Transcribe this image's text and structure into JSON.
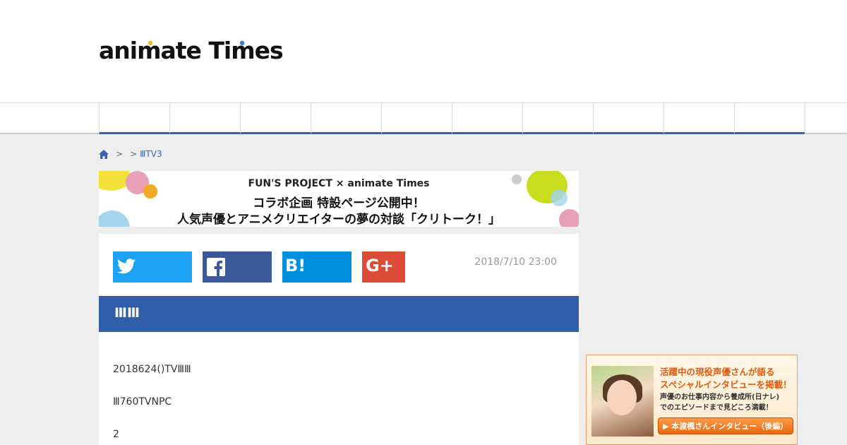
{
  "header": {
    "logo_part1": "an",
    "logo_i": "i",
    "logo_part2": "mate T",
    "logo_part3": "i",
    "logo_part4": "mes"
  },
  "breadcrumb": {
    "home_icon": "home-icon",
    "sep1": ">",
    "sep2": ">",
    "current": "ⅢTV3"
  },
  "banner": {
    "brand": "FUN'S PROJECT × animate Times",
    "line1": "コラボ企画 特設ページ公開中！",
    "line2": "人気声優とアニメクリエイターの夢の対談「クリトーク！」"
  },
  "article": {
    "date": "2018/7/10 23:00",
    "title": "ⅢⅢ",
    "paragraphs": [
      "2018624()TVⅢⅢ",
      "Ⅲ760TVNPC",
      "2"
    ]
  },
  "share": {
    "twitter_icon": "twitter-icon",
    "facebook_icon": "facebook-icon",
    "hatena_icon": "hatena-bookmark-icon",
    "gplus_icon": "google-plus-icon",
    "colors": {
      "twitter": "#1da1f2",
      "facebook": "#3b5998",
      "hatena": "#008fde",
      "gplus": "#dd4b39"
    }
  },
  "ad": {
    "headline1": "活躍中の現役声優さんが語る",
    "headline2": "スペシャルインタビューを掲載！",
    "sub1": "声優のお仕事内容から養成所(日ナレ)",
    "sub2": "でのエピソードまで見どころ満載！",
    "button": "▶ 本渡楓さんインタビュー（後編）"
  },
  "theme": {
    "accent": "#315ea8",
    "background": "#eeeeee"
  }
}
